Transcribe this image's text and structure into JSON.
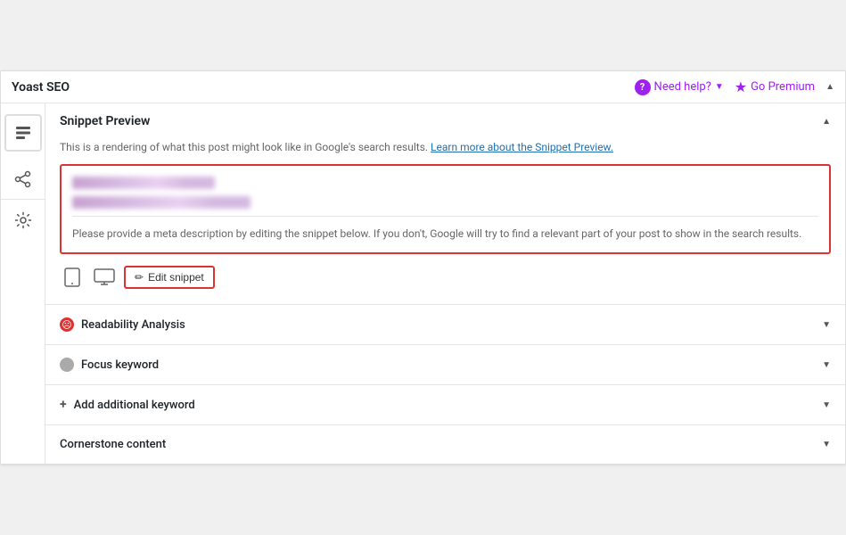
{
  "header": {
    "title": "Yoast SEO",
    "help_label": "Need help?",
    "go_premium_label": "Go Premium",
    "collapse_arrow": "▲"
  },
  "sidebar": {
    "icons": [
      {
        "name": "seo-icon",
        "symbol": "☰"
      },
      {
        "name": "share-icon",
        "symbol": "⤢"
      },
      {
        "name": "settings-icon",
        "symbol": "⚙"
      }
    ]
  },
  "snippet_preview": {
    "section_title": "Snippet Preview",
    "description": "This is a rendering of what this post might look like in Google's search results.",
    "learn_more_label": "Learn more about the Snippet Preview.",
    "blurred_title": "Investor Email",
    "blurred_url": "https://investoremail.com",
    "meta_note": "Please provide a meta description by editing the snippet below. If you don't, Google will try to find a relevant part of your post to show in the search results.",
    "edit_snippet_label": "Edit snippet",
    "collapse_arrow": "▲"
  },
  "collapsible_sections": [
    {
      "id": "readability",
      "icon_type": "dot-red",
      "icon_symbol": "☹",
      "label": "Readability Analysis",
      "arrow": "▼"
    },
    {
      "id": "focus-keyword",
      "icon_type": "dot-gray",
      "icon_symbol": "",
      "label": "Focus keyword",
      "arrow": "▼"
    },
    {
      "id": "add-keyword",
      "icon_type": "plus",
      "icon_symbol": "+",
      "label": "Add additional keyword",
      "arrow": "▼"
    },
    {
      "id": "cornerstone",
      "icon_type": "none",
      "icon_symbol": "",
      "label": "Cornerstone content",
      "arrow": "▼"
    }
  ]
}
